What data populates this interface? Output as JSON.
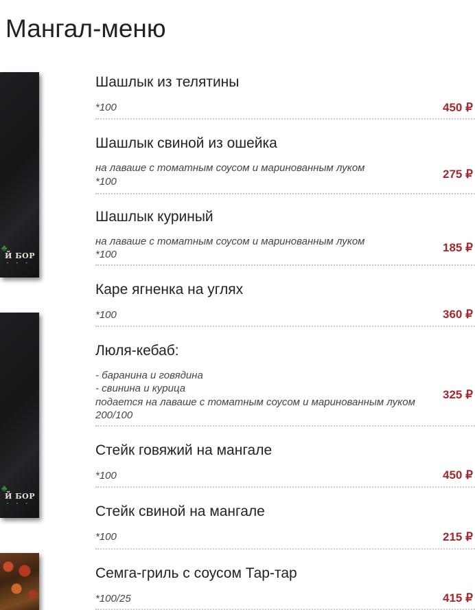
{
  "page": {
    "title": "Мангал-меню"
  },
  "photos": {
    "logo_text": "Й БОР",
    "logo_dots": "• • •",
    "tree_glyph": "♣"
  },
  "colors": {
    "price": "#a3282e",
    "text": "#222222",
    "description": "#444444",
    "divider": "#c8c8c8"
  },
  "menu": {
    "items": [
      {
        "name": "Шашлык из телятины",
        "lines": [
          "*100"
        ],
        "price": "450 ₽"
      },
      {
        "name": "Шашлык свиной из ошейка",
        "lines": [
          "на лаваше с томатным соусом и маринованным луком",
          "*100"
        ],
        "price": "275 ₽"
      },
      {
        "name": "Шашлык куриный",
        "lines": [
          "на лаваше с томатным соусом и маринованным луком",
          "*100"
        ],
        "price": "185 ₽"
      },
      {
        "name": "Каре ягненка на углях",
        "lines": [
          "*100"
        ],
        "price": "360 ₽"
      },
      {
        "name": "Люля-кебаб:",
        "lines": [
          "- баранина и говядина",
          "- свинина и курица",
          "подается на лаваше с томатным соусом и маринованным луком",
          "200/100"
        ],
        "price": "325 ₽"
      },
      {
        "name": "Стейк говяжий на мангале",
        "lines": [
          "*100"
        ],
        "price": "450 ₽"
      },
      {
        "name": "Стейк свиной на мангале",
        "lines": [
          "*100"
        ],
        "price": "215 ₽"
      },
      {
        "name": "Семга-гриль с соусом Тар-тар",
        "lines": [
          "*100/25"
        ],
        "price": "415 ₽"
      }
    ]
  }
}
